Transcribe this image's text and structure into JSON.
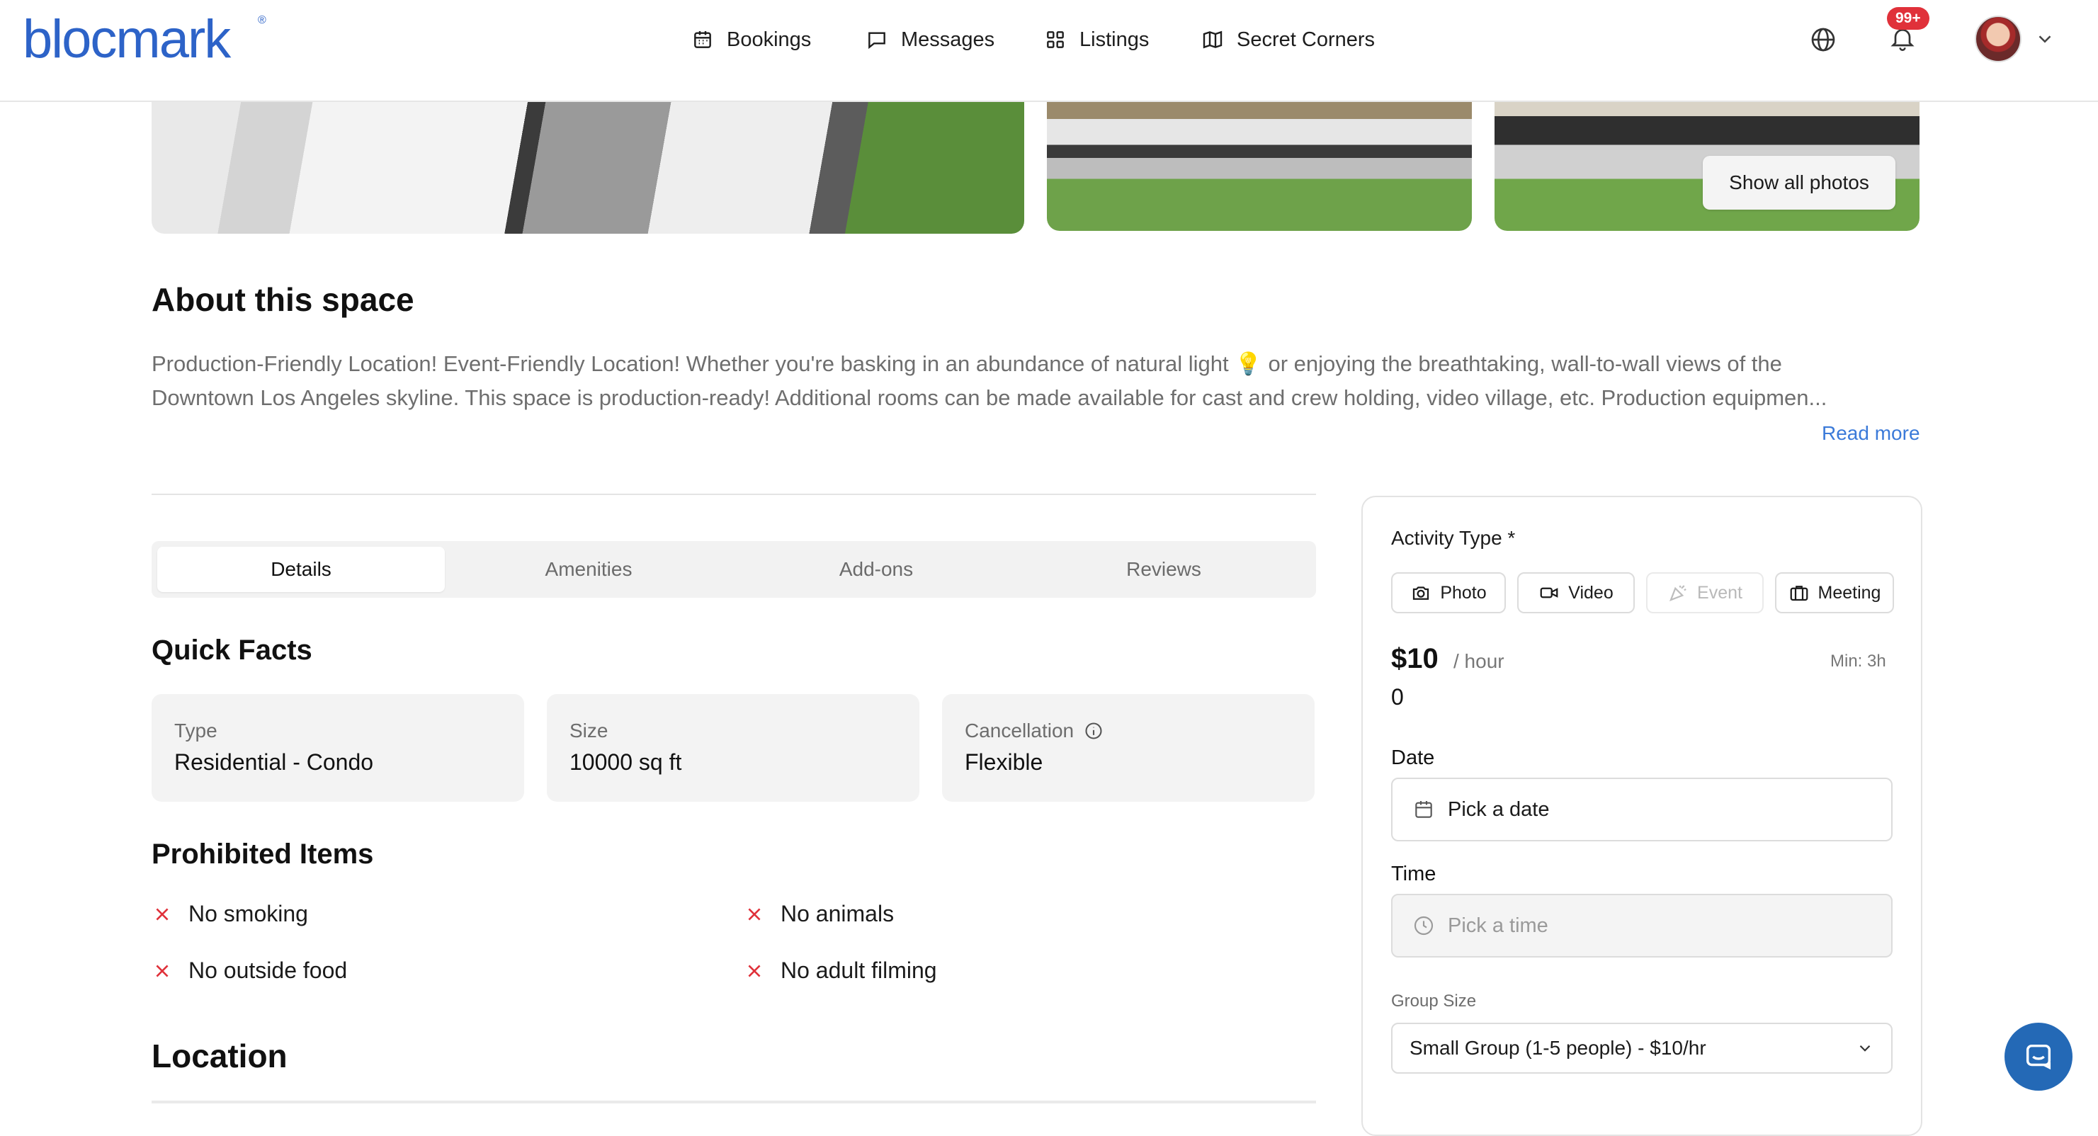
{
  "header": {
    "logo": "blocmark",
    "logo_mark": "®",
    "nav": [
      {
        "label": "Bookings",
        "icon": "calendar-icon"
      },
      {
        "label": "Messages",
        "icon": "message-icon"
      },
      {
        "label": "Listings",
        "icon": "grid-icon"
      },
      {
        "label": "Secret Corners",
        "icon": "map-icon"
      }
    ],
    "notification_badge": "99+",
    "icons": [
      "globe-icon",
      "bell-icon",
      "avatar",
      "chevron-down-icon"
    ]
  },
  "gallery": {
    "show_all_label": "Show all photos"
  },
  "about": {
    "title": "About this space",
    "line1": "Production-Friendly Location! Event-Friendly Location! Whether you're basking in an abundance of natural light 💡 or enjoying the breathtaking, wall-to-wall views of the",
    "line2": "Downtown Los Angeles skyline. This space is production-ready! Additional rooms can be made available for cast and crew holding, video village, etc. Production equipmen...",
    "read_more": "Read more"
  },
  "tabs": [
    "Details",
    "Amenities",
    "Add-ons",
    "Reviews"
  ],
  "active_tab": "Details",
  "quick_facts": {
    "title": "Quick Facts",
    "items": [
      {
        "label": "Type",
        "value": "Residential - Condo"
      },
      {
        "label": "Size",
        "value": "10000 sq ft"
      },
      {
        "label": "Cancellation",
        "value": "Flexible"
      }
    ]
  },
  "prohibited": {
    "title": "Prohibited Items",
    "items": [
      "No smoking",
      "No animals",
      "No outside food",
      "No adult filming"
    ]
  },
  "location": {
    "title": "Location"
  },
  "booking": {
    "activity_label": "Activity Type *",
    "activities": [
      {
        "label": "Photo",
        "icon": "camera-icon",
        "enabled": true
      },
      {
        "label": "Video",
        "icon": "video-icon",
        "enabled": true
      },
      {
        "label": "Event",
        "icon": "party-icon",
        "enabled": false
      },
      {
        "label": "Meeting",
        "icon": "briefcase-icon",
        "enabled": true
      }
    ],
    "price": "$10",
    "price_unit": "/ hour",
    "min_label": "Min: 3h",
    "count": "0",
    "date_label": "Date",
    "date_placeholder": "Pick a date",
    "time_label": "Time",
    "time_placeholder": "Pick a time",
    "group_size_label": "Group Size",
    "group_size_value": "Small Group (1-5 people) - $10/hr"
  },
  "colors": {
    "brand": "#2d63c8",
    "link": "#3b7ad9",
    "badge": "#e0313a",
    "prohibited_x": "#e0313a",
    "chat_launcher": "#2469b6"
  }
}
